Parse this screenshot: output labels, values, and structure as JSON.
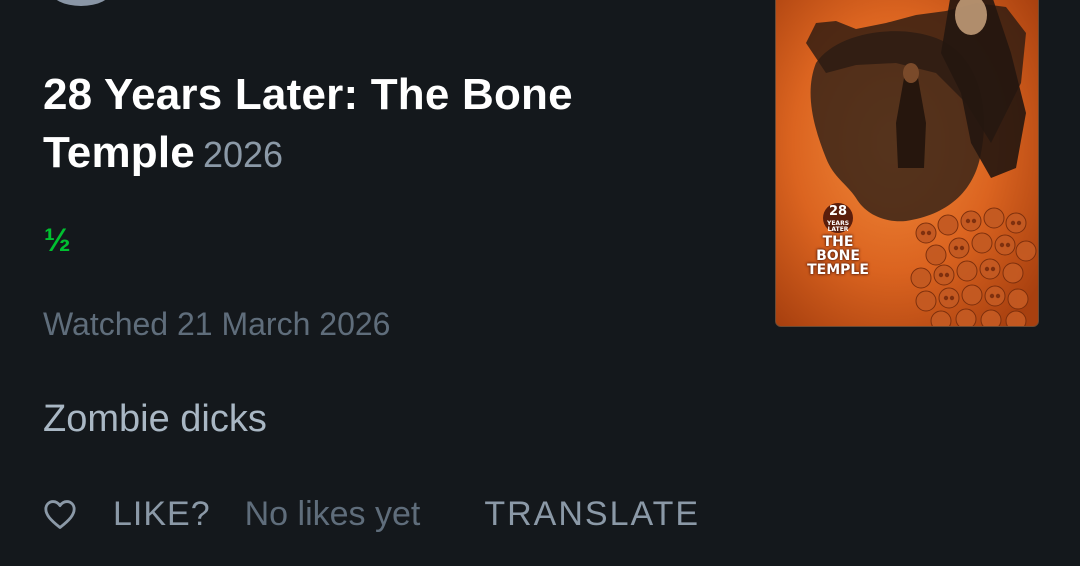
{
  "film": {
    "title": "28 Years Later: The Bone Temple",
    "year": "2026"
  },
  "rating": {
    "display": "½",
    "value_stars": 0.5
  },
  "watched": {
    "text": "Watched 21 March 2026"
  },
  "review": {
    "text": "Zombie dicks"
  },
  "actions": {
    "like_label": "LIKE?",
    "likes_count": "No likes yet",
    "translate_label": "TRANSLATE"
  },
  "poster": {
    "logo_number": "28",
    "logo_small": "YEARS LATER",
    "logo_line1": "THE BONE",
    "logo_line2": "TEMPLE"
  },
  "colors": {
    "background": "#14181c",
    "rating_green": "#00c030",
    "muted_text": "#8b99a7",
    "dim_text": "#5f6d7b",
    "poster_orange": "#e0661f"
  },
  "icons": {
    "heart": "heart-outline-icon"
  }
}
